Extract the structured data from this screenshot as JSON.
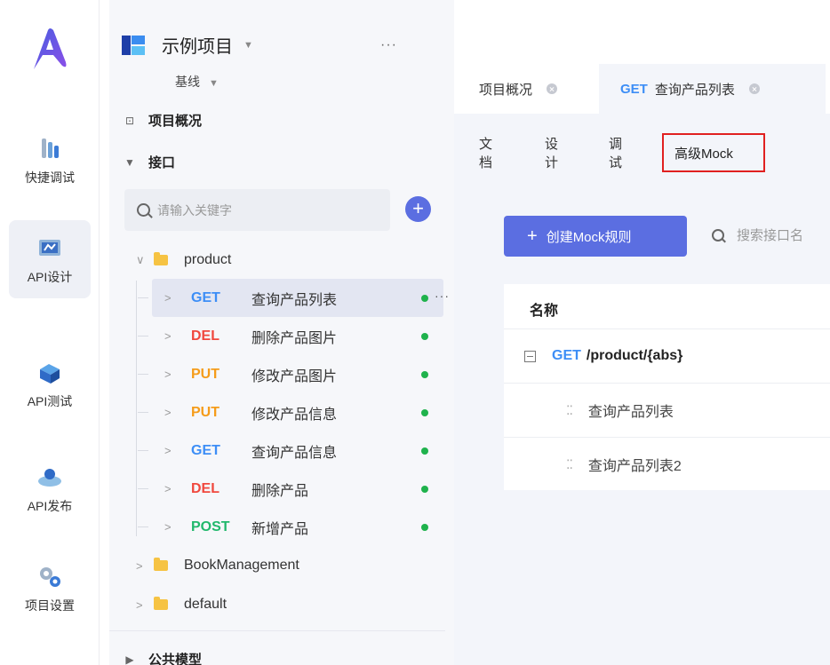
{
  "rail": {
    "items": [
      {
        "label": "快捷调试",
        "icon": "quick-debug-icon"
      },
      {
        "label": "API设计",
        "icon": "api-design-icon",
        "active": true
      },
      {
        "label": "API测试",
        "icon": "api-test-icon"
      },
      {
        "label": "API发布",
        "icon": "api-publish-icon"
      },
      {
        "label": "项目设置",
        "icon": "project-settings-icon"
      }
    ]
  },
  "project": {
    "title": "示例项目",
    "baseline": "基线"
  },
  "tree": {
    "overview": "项目概况",
    "interfaces": "接口",
    "search_placeholder": "请输入关键字",
    "folder_product": "product",
    "apis": [
      {
        "method": "GET",
        "name": "查询产品列表",
        "active": true
      },
      {
        "method": "DEL",
        "name": "删除产品图片"
      },
      {
        "method": "PUT",
        "name": "修改产品图片"
      },
      {
        "method": "PUT",
        "name": "修改产品信息"
      },
      {
        "method": "GET",
        "name": "查询产品信息"
      },
      {
        "method": "DEL",
        "name": "删除产品"
      },
      {
        "method": "POST",
        "name": "新增产品"
      }
    ],
    "folder_book": "BookManagement",
    "folder_default": "default",
    "public_models": "公共模型"
  },
  "tabs": {
    "overview": "项目概况",
    "active_method": "GET",
    "active_name": "查询产品列表"
  },
  "subtabs": [
    "文档",
    "设计",
    "调试",
    "高级Mock"
  ],
  "mock": {
    "create_label": "创建Mock规则",
    "search_placeholder": "搜索接口名",
    "col_name": "名称",
    "group_method": "GET",
    "group_path": "/product/{abs}",
    "rules": [
      "查询产品列表",
      "查询产品列表2"
    ]
  },
  "colors": {
    "accent": "#5b6ee1",
    "get": "#3d8ef6",
    "del": "#f0483e",
    "put": "#f59c1a",
    "post": "#21b86c",
    "highlight_box": "#e02020"
  }
}
